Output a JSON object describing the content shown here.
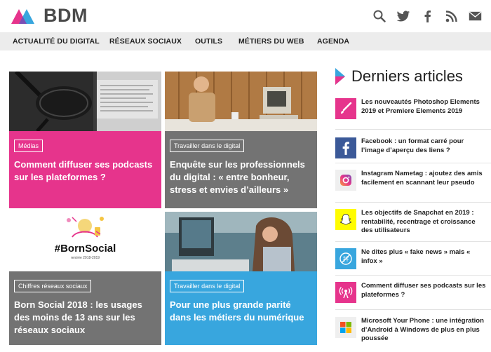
{
  "site": {
    "name": "BDM"
  },
  "header": {
    "icons": [
      "search-icon",
      "twitter-icon",
      "facebook-icon",
      "rss-icon",
      "mail-icon"
    ]
  },
  "nav": {
    "items": [
      {
        "label": "ACTUALITÉ DU DIGITAL"
      },
      {
        "label": "RÉSEAUX SOCIAUX"
      },
      {
        "label": "OUTILS"
      },
      {
        "label": "MÉTIERS DU WEB"
      },
      {
        "label": "AGENDA"
      }
    ]
  },
  "cards": [
    {
      "tag": "Médias",
      "title": "Comment diffuser ses podcasts sur les plateformes ?",
      "color": "#e6348c",
      "image": "podcast-microphone-image"
    },
    {
      "tag": "Travailler dans le digital",
      "title": "Enquête sur les professionnels du digital : « entre bonheur, stress et envies d’ailleurs »",
      "color": "#737373",
      "image": "retro-computer-desk-image"
    },
    {
      "tag": "Chiffres réseaux sociaux",
      "title": "Born Social 2018 : les usages des moins de 13 ans sur les réseaux sociaux",
      "color": "#737373",
      "image": "born-social-illustration",
      "image_text": {
        "hashtag": "#BornSocial",
        "caption": "rentrée 2018-2019"
      }
    },
    {
      "tag": "Travailler dans le digital",
      "title": "Pour une plus grande parité dans les métiers du numérique",
      "color": "#38a6de",
      "image": "woman-at-computer-image"
    }
  ],
  "sidebar": {
    "title": "Derniers articles",
    "items": [
      {
        "icon": "brush-icon",
        "icon_bg": "#e6348c",
        "text": "Les nouveautés Photoshop Elements 2019 et Premiere Elements 2019"
      },
      {
        "icon": "facebook-icon",
        "icon_bg": "#3b5998",
        "text": "Facebook : un format carré pour l’image d’aperçu des liens ?"
      },
      {
        "icon": "instagram-icon",
        "icon_bg": "#efefef",
        "text": "Instagram Nametag : ajoutez des amis facilement en scannant leur pseudo"
      },
      {
        "icon": "snapchat-icon",
        "icon_bg": "#fffc00",
        "text": "Les objectifs de Snapchat en 2019 : rentabilité, recentrage et croissance des utilisateurs"
      },
      {
        "icon": "no-fake-news-icon",
        "icon_bg": "#38a6de",
        "text": "Ne dites plus « fake news » mais « infox »"
      },
      {
        "icon": "broadcast-icon",
        "icon_bg": "#e6348c",
        "text": "Comment diffuser ses podcasts sur les plateformes ?"
      },
      {
        "icon": "windows-icon",
        "icon_bg": "#efefef",
        "text": "Microsoft Your Phone : une intégration d’Android à Windows de plus en plus poussée"
      }
    ]
  }
}
